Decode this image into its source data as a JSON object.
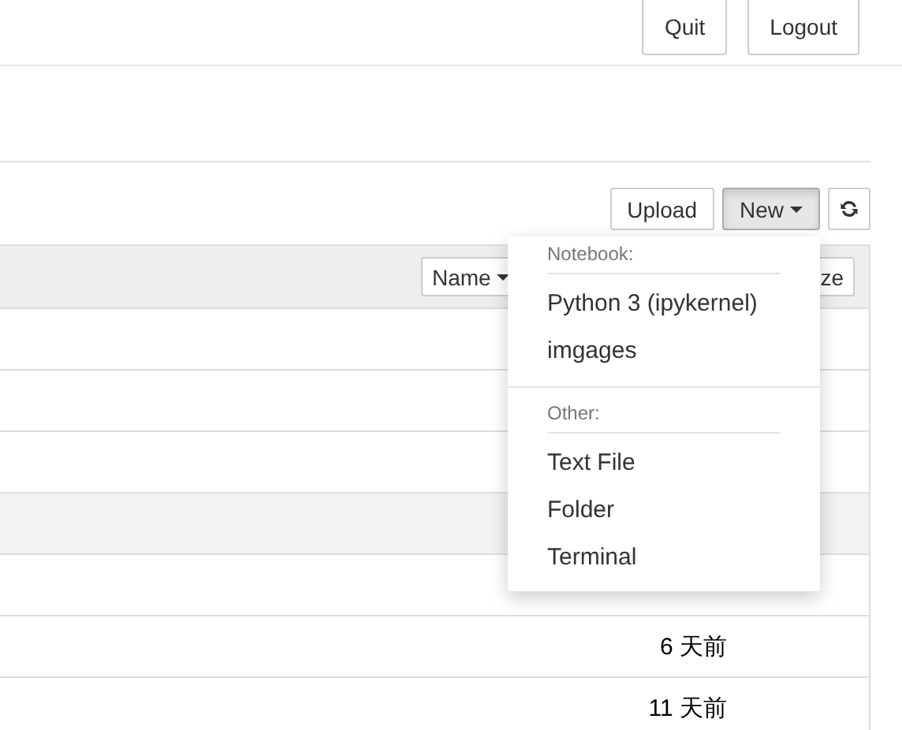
{
  "header": {
    "buttons": [
      "Quit",
      "Logout"
    ]
  },
  "toolbar": {
    "upload": "Upload",
    "new": {
      "label": "New",
      "pressed": true
    }
  },
  "table": {
    "sort_button": "Name",
    "column_button": "ze",
    "rows": [
      {
        "highlighted": false
      },
      {
        "highlighted": false
      },
      {
        "highlighted": false
      },
      {
        "highlighted": true
      },
      {
        "highlighted": false
      },
      {
        "highlighted": false,
        "modified": "6 天前"
      },
      {
        "highlighted": false,
        "modified": "11 天前"
      }
    ]
  },
  "new_menu": {
    "sections": [
      {
        "heading": "Notebook:",
        "items": [
          "Python 3 (ipykernel)",
          "imgages"
        ]
      },
      {
        "heading": "Other:",
        "items": [
          "Text File",
          "Folder",
          "Terminal"
        ]
      }
    ]
  }
}
